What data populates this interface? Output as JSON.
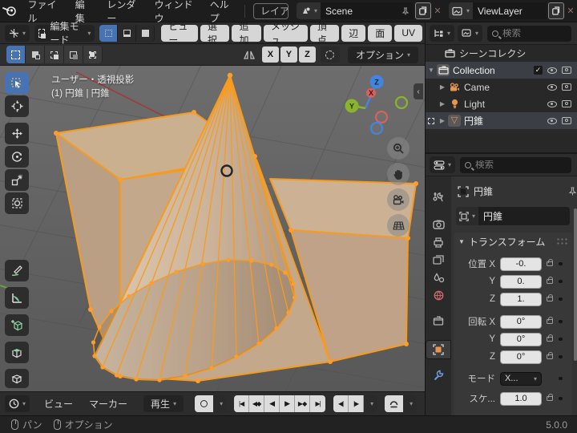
{
  "topbar": {
    "menus": [
      "ファイル",
      "編集",
      "レンダー",
      "ウィンドウ",
      "ヘルプ"
    ],
    "workspace_tab": "レイア",
    "scene": {
      "value": "Scene"
    },
    "viewlayer": {
      "value": "ViewLayer"
    }
  },
  "viewport_header": {
    "mode_label": "編集モード",
    "menus": [
      "ビュー",
      "選択",
      "追加",
      "メッシュ",
      "頂点",
      "辺",
      "面",
      "UV"
    ]
  },
  "tool_settings": {
    "axis": [
      "X",
      "Y",
      "Z"
    ],
    "options_label": "オプション"
  },
  "viewport": {
    "overlay_line1": "ユーザー・透視投影",
    "overlay_line2": "(1) 円錐 | 円錐",
    "gizmo": {
      "x": "X",
      "y": "Y",
      "z": "Z"
    },
    "sidebar_toggle": "‹"
  },
  "outliner": {
    "search_placeholder": "検索",
    "rows": [
      {
        "label": "シーンコレクシ"
      },
      {
        "label": "Collection"
      },
      {
        "label": "Came"
      },
      {
        "label": "Light"
      },
      {
        "label": "円錐"
      }
    ]
  },
  "properties": {
    "search_placeholder": "検索",
    "breadcrumb": "円錐",
    "object_name": "円錐",
    "panel_title": "トランスフォーム",
    "rows": [
      {
        "label": "位置 X",
        "value": "-0."
      },
      {
        "label": "Y",
        "value": "0."
      },
      {
        "label": "Z",
        "value": "1."
      },
      {
        "label": "回転 X",
        "value": "0°"
      },
      {
        "label": "Y",
        "value": "0°"
      },
      {
        "label": "Z",
        "value": "0°"
      },
      {
        "label": "モード",
        "value": "X..."
      },
      {
        "label": "スケ...",
        "value": "1.0"
      }
    ]
  },
  "timeline": {
    "menus": [
      "ビュー",
      "マーカー"
    ],
    "play_label": "再生",
    "playback": [
      "|◀",
      "◀◆",
      "◀",
      "▶",
      "▶◆",
      "▶|"
    ],
    "steps": [
      "◀|",
      "|▶"
    ]
  },
  "statusbar": {
    "items": [
      {
        "label": "パン"
      },
      {
        "label": "オプション"
      }
    ],
    "version": "5.0.0"
  },
  "colors": {
    "accent_blue": "#4772b3",
    "selection_orange": "#ff9d2b",
    "object_orange": "#e8964f"
  }
}
